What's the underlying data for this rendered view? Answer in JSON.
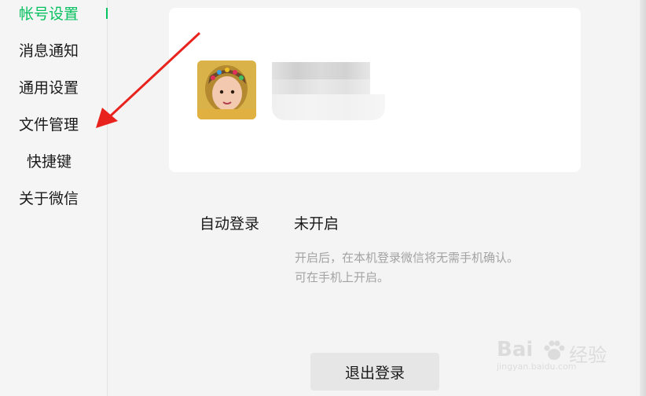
{
  "sidebar": {
    "items": [
      {
        "label": "帐号设置",
        "active": true
      },
      {
        "label": "消息通知"
      },
      {
        "label": "通用设置"
      },
      {
        "label": "文件管理"
      },
      {
        "label": "快捷键"
      },
      {
        "label": "关于微信"
      }
    ]
  },
  "settings": {
    "auto_login_label": "自动登录",
    "auto_login_value": "未开启",
    "desc_line1": "开启后，在本机登录微信将无需手机确认。",
    "desc_line2": "可在手机上开启。"
  },
  "logout_label": "退出登录",
  "watermark": {
    "brand": "Bai",
    "brand_suffix": "经验",
    "url": "jingyan.baidu.com"
  },
  "colors": {
    "accent": "#07c160",
    "arrow": "#e8231e",
    "card": "#ffffff",
    "background": "#f4f4f4"
  },
  "icons": [
    "red-arrow-annotation",
    "paw-icon"
  ]
}
